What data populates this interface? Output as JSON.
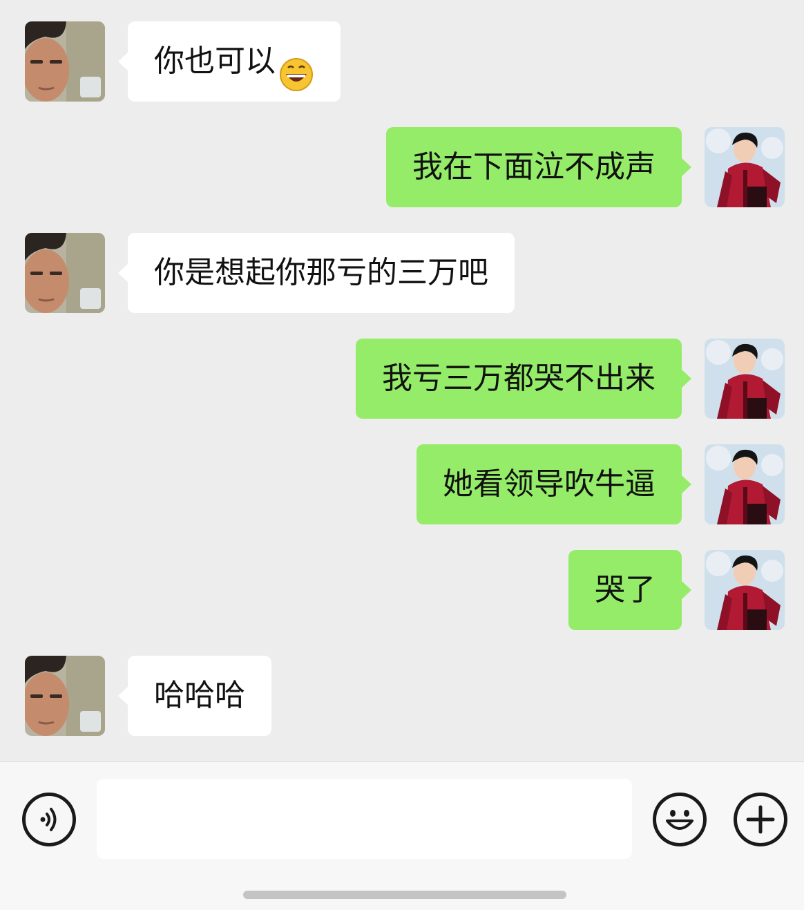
{
  "messages": [
    {
      "side": "left",
      "text": "你也可以",
      "emoji": "grinning-face-emoji"
    },
    {
      "side": "right",
      "text": "我在下面泣不成声"
    },
    {
      "side": "left",
      "text": "你是想起你那亏的三万吧"
    },
    {
      "side": "right",
      "text": "我亏三万都哭不出来"
    },
    {
      "side": "right",
      "text": "她看领导吹牛逼"
    },
    {
      "side": "right",
      "text": "哭了"
    },
    {
      "side": "left",
      "text": "哈哈哈"
    }
  ],
  "input_bar": {
    "voice_icon": "voice-icon",
    "emoji_icon": "smiley-icon",
    "more_icon": "plus-icon",
    "input_value": ""
  },
  "colors": {
    "background": "#ededed",
    "sent_bubble": "#95ec69",
    "received_bubble": "#ffffff"
  }
}
